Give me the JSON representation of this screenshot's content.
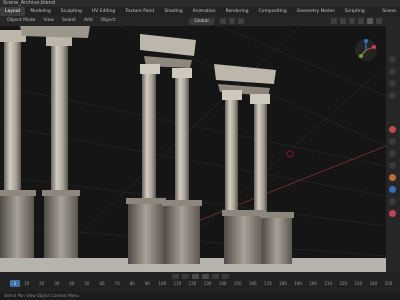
{
  "app": {
    "title": "Scene_Archive.blend"
  },
  "menubar": {
    "workspaces": [
      "Layout",
      "Modeling",
      "Sculpting",
      "UV Editing",
      "Texture Paint",
      "Shading",
      "Animation",
      "Rendering",
      "Compositing",
      "Geometry Nodes",
      "Scripting"
    ],
    "active_workspace": "Layout",
    "scene_label": "Scene"
  },
  "header": {
    "items": [
      "Object Mode",
      "View",
      "Select",
      "Add",
      "Object"
    ],
    "orientation": "Global"
  },
  "timeline": {
    "current_frame": "1",
    "frames": [
      "0",
      "10",
      "20",
      "30",
      "40",
      "50",
      "60",
      "70",
      "80",
      "90",
      "100",
      "110",
      "120",
      "130",
      "140",
      "150",
      "160",
      "170",
      "180",
      "190",
      "200",
      "210",
      "220",
      "230",
      "240",
      "250"
    ]
  },
  "status": {
    "text": "Select    Pan View    Object Context Menu"
  },
  "viewport": {
    "bg_color": "#171717",
    "grid_color": "#2b2b2b",
    "x_axis_color": "#8a3040",
    "marble_light": "#c9c3b8",
    "marble_dark": "#5b5650"
  }
}
